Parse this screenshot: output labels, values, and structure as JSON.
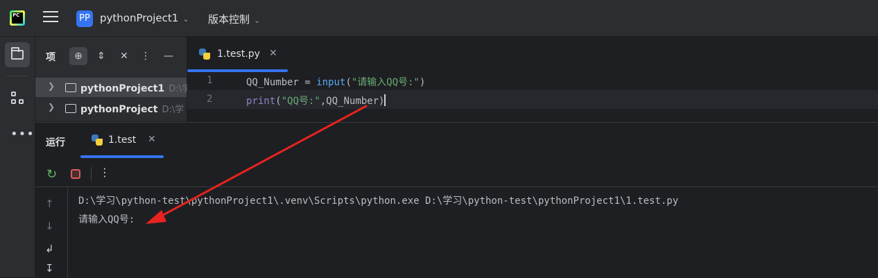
{
  "titlebar": {
    "app_logo": "PC",
    "menu_icon": "hamburger-menu-icon",
    "project_badge": "PP",
    "project_name": "pythonProject1",
    "vcs_label": "版本控制"
  },
  "project_panel": {
    "title": "项",
    "tree": [
      {
        "name": "pythonProject1",
        "path": "D:\\学"
      },
      {
        "name": "pythonProject",
        "path": "D:\\学"
      }
    ]
  },
  "editor": {
    "tab_label": "1.test.py",
    "lines": [
      {
        "number": "1",
        "code": "QQ_Number = input(\"请输入QQ号:\")"
      },
      {
        "number": "2",
        "code": "print(\"QQ号:\",QQ_Number)"
      }
    ]
  },
  "run_panel": {
    "title": "运行",
    "tab_label": "1.test",
    "console_lines": [
      "D:\\学习\\python-test\\pythonProject1\\.venv\\Scripts\\python.exe D:\\学习\\python-test\\pythonProject1\\1.test.py",
      "请输入QQ号:"
    ]
  },
  "colors": {
    "accent": "#3574f0",
    "arrow": "#e8231f"
  }
}
